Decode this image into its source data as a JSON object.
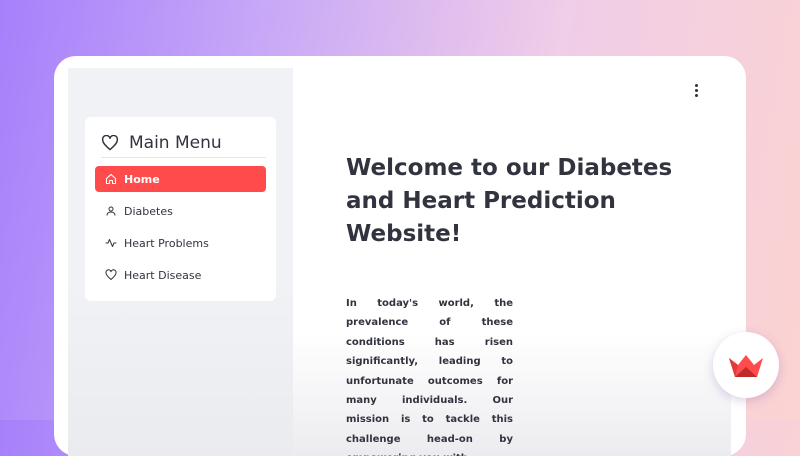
{
  "colors": {
    "accent": "#ff4b4b",
    "text": "#31333f",
    "sidebar_bg": "#f0f2f6"
  },
  "sidebar": {
    "menu_title": "Main Menu",
    "menu_icon": "heart-icon",
    "items": [
      {
        "label": "Home",
        "icon": "house-icon",
        "active": true
      },
      {
        "label": "Diabetes",
        "icon": "person-icon",
        "active": false
      },
      {
        "label": "Heart Problems",
        "icon": "activity-icon",
        "active": false
      },
      {
        "label": "Heart Disease",
        "icon": "heart-icon",
        "active": false
      }
    ]
  },
  "main": {
    "title": "Welcome to our Diabetes and Heart Prediction Website!",
    "mission_text": "In today's world, the prevalence of these conditions has risen significantly, leading to unfortunate outcomes for many individuals. Our mission is to tackle this challenge head-on by empowering you with"
  },
  "toolbar": {
    "menu_icon": "kebab-menu-icon"
  },
  "badge": {
    "icon": "crown-logo-icon"
  }
}
